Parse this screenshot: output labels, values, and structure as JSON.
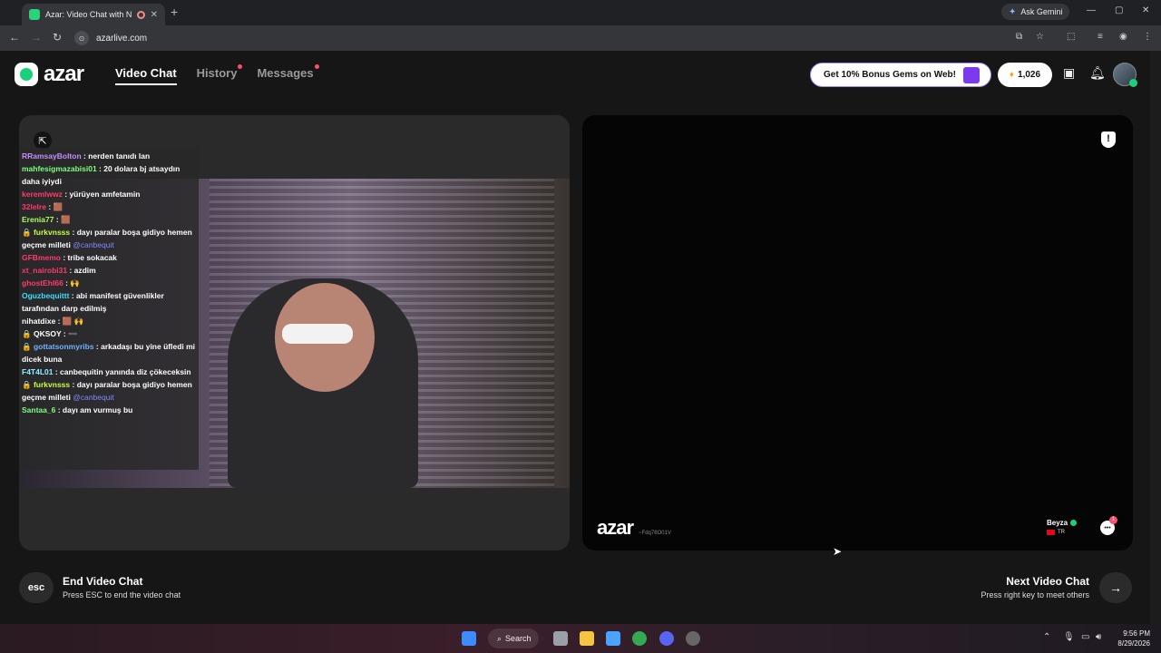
{
  "browser": {
    "tab_title": "Azar: Video Chat with New",
    "new_tab": "+",
    "ask_gemini": "Ask Gemini",
    "url": "azarlive.com",
    "win_minimize": "—",
    "win_restore": "▢",
    "win_close": "✕"
  },
  "header": {
    "logo": "azar",
    "nav": [
      {
        "label": "Video Chat",
        "active": true
      },
      {
        "label": "History",
        "dot": true
      },
      {
        "label": "Messages",
        "dot": true
      }
    ],
    "bonus": "Get 10% Bonus Gems on Web!",
    "gems": "1,026"
  },
  "chat": [
    {
      "user": "RRamsayBolton",
      "color": "#c58cff",
      "text": " : nerden tanıdı lan"
    },
    {
      "user": "mahfesigmazabisi01",
      "color": "#7fff7f",
      "text": " : 20 dolara bj atsaydın daha iyiydi"
    },
    {
      "user": "keremlwwz",
      "color": "#ff3a6a",
      "text": " : yürüyen amfetamin"
    },
    {
      "user": "32lelre",
      "color": "#ff3a6a",
      "text": " : 🟫"
    },
    {
      "user": "Erenia77",
      "color": "#a8ff5c",
      "text": " : 🟫"
    },
    {
      "user": "furkvnsss",
      "color": "#c7ff3a",
      "text": " : dayı paralar boşa gidiyo hemen geçme milleti ",
      "mention": "@canbequit",
      "badge": "🔒"
    },
    {
      "user": "GFBmemo",
      "color": "#ff3a6a",
      "text": " : tribe sokacak"
    },
    {
      "user": "xt_nairobi31",
      "color": "#ff3a6a",
      "text": " : azdim"
    },
    {
      "user": "ghostEhl66",
      "color": "#ff3a6a",
      "text": " : 🙌"
    },
    {
      "user": "Oguzbequittt",
      "color": "#3ae0ff",
      "text": " : abi manifest güvenlikler tarafından darp edilmiş"
    },
    {
      "user": "nihatdixe",
      "color": "#ffffff",
      "text": " : 🟫 🙌"
    },
    {
      "user": "QKSOY",
      "color": "#ffffff",
      "text": " : ➖",
      "badge": "🔒"
    },
    {
      "user": "gottatsonmyribs",
      "color": "#6fb3ff",
      "text": " : arkadaşı bu yine üfledi mi dicek buna",
      "badge": "🔒"
    },
    {
      "user": "F4T4L01",
      "color": "#8cf0ff",
      "text": " : canbequitin yanında diz çökeceksin"
    },
    {
      "user": "furkvnsss",
      "color": "#c7ff3a",
      "text": " : dayı paralar boşa gidiyo hemen geçme milleti ",
      "mention": "@canbequit",
      "badge": "🔒"
    },
    {
      "user": "Santaa_6",
      "color": "#7fff7f",
      "text": " : dayı am vurmuş bu"
    }
  ],
  "partner": {
    "watermark": "azar",
    "watermark_id": "~Fdq78O01V",
    "name": "Beyza",
    "country": "TR",
    "chat_badge": "1"
  },
  "actions": {
    "esc": "esc",
    "end_title": "End Video Chat",
    "end_sub": "Press ESC to end the video chat",
    "next_title": "Next Video Chat",
    "next_sub": "Press right key to meet others"
  },
  "taskbar": {
    "search": "Search",
    "time": "9:56 PM",
    "date": "8/29/2026"
  }
}
